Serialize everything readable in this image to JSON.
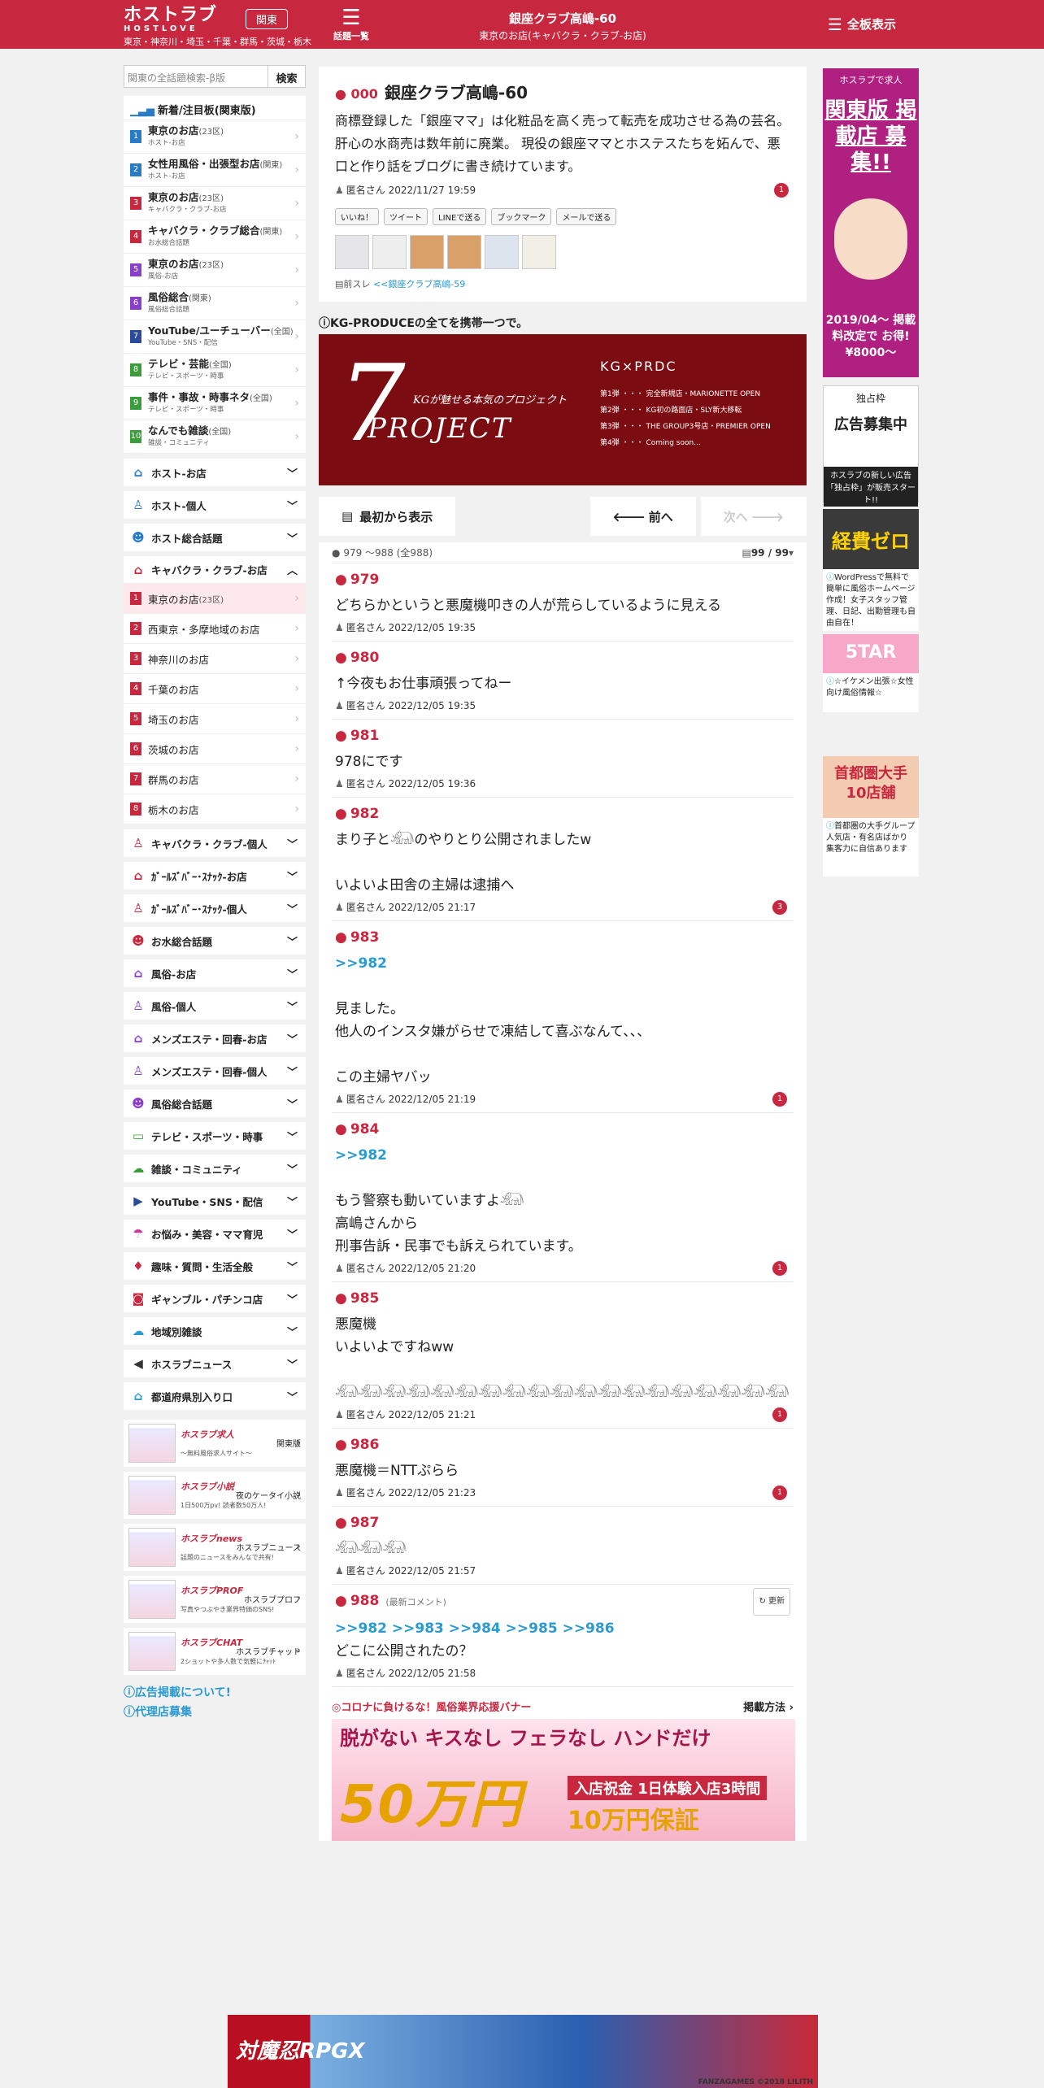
{
  "header": {
    "logo": "ホストラブ",
    "logo_en": "HOSTLOVE",
    "region": "関東",
    "areas": "東京・神奈川・埼玉・千葉・群馬・茨城・栃木",
    "topics_label": "話題一覧",
    "title": "銀座クラブ高嶋-60",
    "subtitle": "東京のお店(キャバクラ・クラブ-お店)",
    "all_label": "全板表示"
  },
  "search": {
    "placeholder": "関東の全話題検索-β版",
    "button": "検索"
  },
  "ranking": {
    "title": "新着/注目板(関東版)",
    "items": [
      {
        "n": "1",
        "label": "東京のお店",
        "tag": "(23区)",
        "sub": "ホスト-お店",
        "color": "#2a7bc6"
      },
      {
        "n": "2",
        "label": "女性用風俗・出張型お店",
        "tag": "(関東)",
        "sub": "ホスト-お店",
        "color": "#2a7bc6"
      },
      {
        "n": "3",
        "label": "東京のお店",
        "tag": "(23区)",
        "sub": "キャバクラ・クラブ-お店",
        "color": "#c8283f"
      },
      {
        "n": "4",
        "label": "キャバクラ・クラブ総合",
        "tag": "(関東)",
        "sub": "お水総合話題",
        "color": "#c8283f"
      },
      {
        "n": "5",
        "label": "東京のお店",
        "tag": "(23区)",
        "sub": "風俗-お店",
        "color": "#8a3fc8"
      },
      {
        "n": "6",
        "label": "風俗総合",
        "tag": "(関東)",
        "sub": "風俗総合話題",
        "color": "#8a3fc8"
      },
      {
        "n": "7",
        "label": "YouTube/ユーチューバー",
        "tag": "(全国)",
        "sub": "YouTube・SNS・配信",
        "color": "#2a4a9c"
      },
      {
        "n": "8",
        "label": "テレビ・芸能",
        "tag": "(全国)",
        "sub": "テレビ・スポーツ・時事",
        "color": "#3a9c3a"
      },
      {
        "n": "9",
        "label": "事件・事故・時事ネタ",
        "tag": "(全国)",
        "sub": "テレビ・スポーツ・時事",
        "color": "#3a9c3a"
      },
      {
        "n": "10",
        "label": "なんでも雑談",
        "tag": "(全国)",
        "sub": "雑談・コミュニティ",
        "color": "#3a9c3a"
      }
    ]
  },
  "cats_a": [
    {
      "icon": "⌂",
      "label": "ホスト-お店",
      "color": "#2a7bc6"
    },
    {
      "icon": "♙",
      "label": "ホスト-個人",
      "color": "#2a7bc6"
    },
    {
      "icon": "☻",
      "label": "ホスト総合話題",
      "color": "#2a7bc6"
    }
  ],
  "kyaba": {
    "icon": "⌂",
    "label": "キャバクラ・クラブ-お店",
    "color": "#c8283f",
    "subs": [
      {
        "n": "1",
        "label": "東京のお店",
        "tag": "(23区)"
      },
      {
        "n": "2",
        "label": "西東京・多摩地域のお店",
        "tag": ""
      },
      {
        "n": "3",
        "label": "神奈川のお店",
        "tag": ""
      },
      {
        "n": "4",
        "label": "千葉のお店",
        "tag": ""
      },
      {
        "n": "5",
        "label": "埼玉のお店",
        "tag": ""
      },
      {
        "n": "6",
        "label": "茨城のお店",
        "tag": ""
      },
      {
        "n": "7",
        "label": "群馬のお店",
        "tag": ""
      },
      {
        "n": "8",
        "label": "栃木のお店",
        "tag": ""
      }
    ]
  },
  "cats_b": [
    {
      "icon": "♙",
      "label": "キャバクラ・クラブ-個人",
      "color": "#c8283f"
    },
    {
      "icon": "⌂",
      "label": "ｶﾞｰﾙｽﾞﾊﾞｰ･ｽﾅｯｸ-お店",
      "color": "#c8283f"
    },
    {
      "icon": "♙",
      "label": "ｶﾞｰﾙｽﾞﾊﾞｰ･ｽﾅｯｸ-個人",
      "color": "#c8283f"
    },
    {
      "icon": "☻",
      "label": "お水総合話題",
      "color": "#c8283f"
    },
    {
      "icon": "⌂",
      "label": "風俗-お店",
      "color": "#8a3fc8"
    },
    {
      "icon": "♙",
      "label": "風俗-個人",
      "color": "#8a3fc8"
    },
    {
      "icon": "⌂",
      "label": "メンズエステ・回春-お店",
      "color": "#8a3fc8"
    },
    {
      "icon": "♙",
      "label": "メンズエステ・回春-個人",
      "color": "#8a3fc8"
    },
    {
      "icon": "☻",
      "label": "風俗総合話題",
      "color": "#8a3fc8"
    },
    {
      "icon": "▭",
      "label": "テレビ・スポーツ・時事",
      "color": "#3a9c3a"
    },
    {
      "icon": "☁",
      "label": "雑談・コミュニティ",
      "color": "#3a9c3a"
    },
    {
      "icon": "▶",
      "label": "YouTube・SNS・配信",
      "color": "#2a4a9c"
    },
    {
      "icon": "☂",
      "label": "お悩み・美容・ママ育児",
      "color": "#c83ca0"
    },
    {
      "icon": "♦",
      "label": "趣味・質問・生活全般",
      "color": "#c8283f"
    },
    {
      "icon": "◙",
      "label": "ギャンブル・パチンコ店",
      "color": "#c8283f"
    },
    {
      "icon": "☁",
      "label": "地域別雑談",
      "color": "#2a9ad0"
    },
    {
      "icon": "◀",
      "label": "ホスラブニュース",
      "color": "#333333"
    },
    {
      "icon": "⌂",
      "label": "都道府県別入り口",
      "color": "#2a9ad0"
    }
  ],
  "promos": [
    {
      "title": "ホスラブ求人",
      "name": "関東版",
      "sub": "～無料風俗求人サイト～"
    },
    {
      "title": "ホスラブ小説",
      "name": "夜のケータイ小説",
      "sub": "1日500万pv! 読者数50万人!"
    },
    {
      "title": "ホスラブnews",
      "name": "ホスラブニュース",
      "sub": "話題のニュースをみんなで共有!"
    },
    {
      "title": "ホスラブPROF",
      "name": "ホスラブプロフ",
      "sub": "写真やつぶやき業界特価のSNS!"
    },
    {
      "title": "ホスラブCHAT",
      "name": "ホスラブチャット",
      "sub": "2ショットや多人数で気軽にﾁｬｯﾄ"
    }
  ],
  "left_links": [
    "広告掲載について!",
    "代理店募集"
  ],
  "thread": {
    "no": "000",
    "title": "銀座クラブ高嶋-60",
    "body": "商標登録した「銀座ママ」は化粧品を高く売って転売を成功させる為の芸名。 肝心の水商売は数年前に廃業。 現役の銀座ママとホステスたちを妬んで、悪口と作り話をブログに書き続けています。",
    "author": "匿名さん 2022/11/27 19:59",
    "badge": "1",
    "shares": [
      "いいね！",
      "ツイート",
      "LINEで送る",
      "ブックマーク",
      "メールで送る"
    ],
    "prev_label": "前スレ",
    "prev_link": "<<銀座クラブ高嶋-59"
  },
  "kg": {
    "heading": "KG-PRODUCEの全てを携帯一つで。",
    "tagline": "KGが魅せる本気のプロジェクト",
    "brand": "KG×PRDC",
    "rows": [
      "第1弾 ・・・ 完全新規店・MARIONETTE OPEN",
      "第2弾 ・・・ KG初の路面店・SLY新大移転",
      "第3弾 ・・・ THE GROUP3号店・PREMIER OPEN",
      "第4弾 ・・・ Coming soon..."
    ]
  },
  "nav": {
    "first": "最初から表示",
    "prev": "前へ",
    "next": "次へ"
  },
  "range": {
    "text": "979 ～988 (全988)",
    "pages": "99 / 99"
  },
  "posts": [
    {
      "no": "979",
      "anchor": "",
      "text": "どちらかというと悪魔機叩きの人が荒らしているように見える",
      "author": "匿名さん 2022/12/05 19:35",
      "badge": "",
      "latest": ""
    },
    {
      "no": "980",
      "anchor": "",
      "text": "↑今夜もお仕事頑張ってねー",
      "author": "匿名さん 2022/12/05 19:35",
      "badge": "",
      "latest": ""
    },
    {
      "no": "981",
      "anchor": "",
      "text": "978にです",
      "author": "匿名さん 2022/12/05 19:36",
      "badge": "",
      "latest": ""
    },
    {
      "no": "982",
      "anchor": "",
      "text": "まり子と𓃰のやりとり公開されましたw\n\nいよいよ田舎の主婦は逮捕へ",
      "author": "匿名さん 2022/12/05 21:17",
      "badge": "3",
      "latest": ""
    },
    {
      "no": "983",
      "anchor": ">>982",
      "text": "\n見ました。\n他人のインスタ嫌がらせで凍結して喜ぶなんて、、、\n\nこの主婦ヤバッ",
      "author": "匿名さん 2022/12/05 21:19",
      "badge": "1",
      "latest": ""
    },
    {
      "no": "984",
      "anchor": ">>982",
      "text": "\nもう警察も動いていますよ𓃰\n高嶋さんから\n刑事告訴・民事でも訴えられています。",
      "author": "匿名さん 2022/12/05 21:20",
      "badge": "1",
      "latest": ""
    },
    {
      "no": "985",
      "anchor": "",
      "text": "悪魔機\nいよいよですねww\n\n𓃰𓃰𓃰𓃰𓃰𓃰𓃰𓃰𓃰𓃰𓃰𓃰𓃰𓃰𓃰𓃰𓃰𓃰𓃰",
      "author": "匿名さん 2022/12/05 21:21",
      "badge": "1",
      "latest": ""
    },
    {
      "no": "986",
      "anchor": "",
      "text": "悪魔機＝NTTぷらら",
      "author": "匿名さん 2022/12/05 21:23",
      "badge": "1",
      "latest": ""
    },
    {
      "no": "987",
      "anchor": "",
      "text": "𓃰𓃰𓃰",
      "author": "匿名さん 2022/12/05 21:57",
      "badge": "",
      "latest": ""
    },
    {
      "no": "988",
      "anchor": ">>982 >>983 >>984 >>985 >>986",
      "text": "どこに公開されたの？",
      "author": "匿名さん 2022/12/05 21:58",
      "badge": "",
      "latest": "(最新コメント)"
    }
  ],
  "update_label": "更新",
  "corona": {
    "title": "◎コロナに負けるな！風俗業界応援バナー",
    "link": "掲載方法",
    "line1": "脱がない キスなし フェラなし ハンドだけ",
    "big": "50万円",
    "box1": "入店祝金 1日体験入店3時間",
    "box2": "10万円保証"
  },
  "ads": {
    "a1": {
      "head": "ホスラブで求人",
      "main": "関東版 掲載店 募集!!",
      "bottom": "2019/04～ 掲載料改定で お得!¥8000～"
    },
    "a2": {
      "head": "独占枠",
      "main": "広告募集中",
      "foot": "ホスラブの新しい広告「独占枠」が販売スタート!!"
    },
    "a3": {
      "main": "経費ゼロ",
      "text": "WordPressで無料で簡単に風俗ホームページ作成！女子スタッフ管理、日記、出勤管理も自由自在！"
    },
    "a4": {
      "main": "5TAR",
      "text": "☆イケメン出張☆女性向け風俗情報☆"
    },
    "a5": {
      "main": "首都圏大手 10店舗",
      "text": "首都圏の大手グループ 人気店・有名店ばかり 集客力に自信あります"
    }
  },
  "bottom_banner": {
    "title": "対魔忍RPGX",
    "copy": "FANZAGAMES ©2018 LILITH"
  }
}
